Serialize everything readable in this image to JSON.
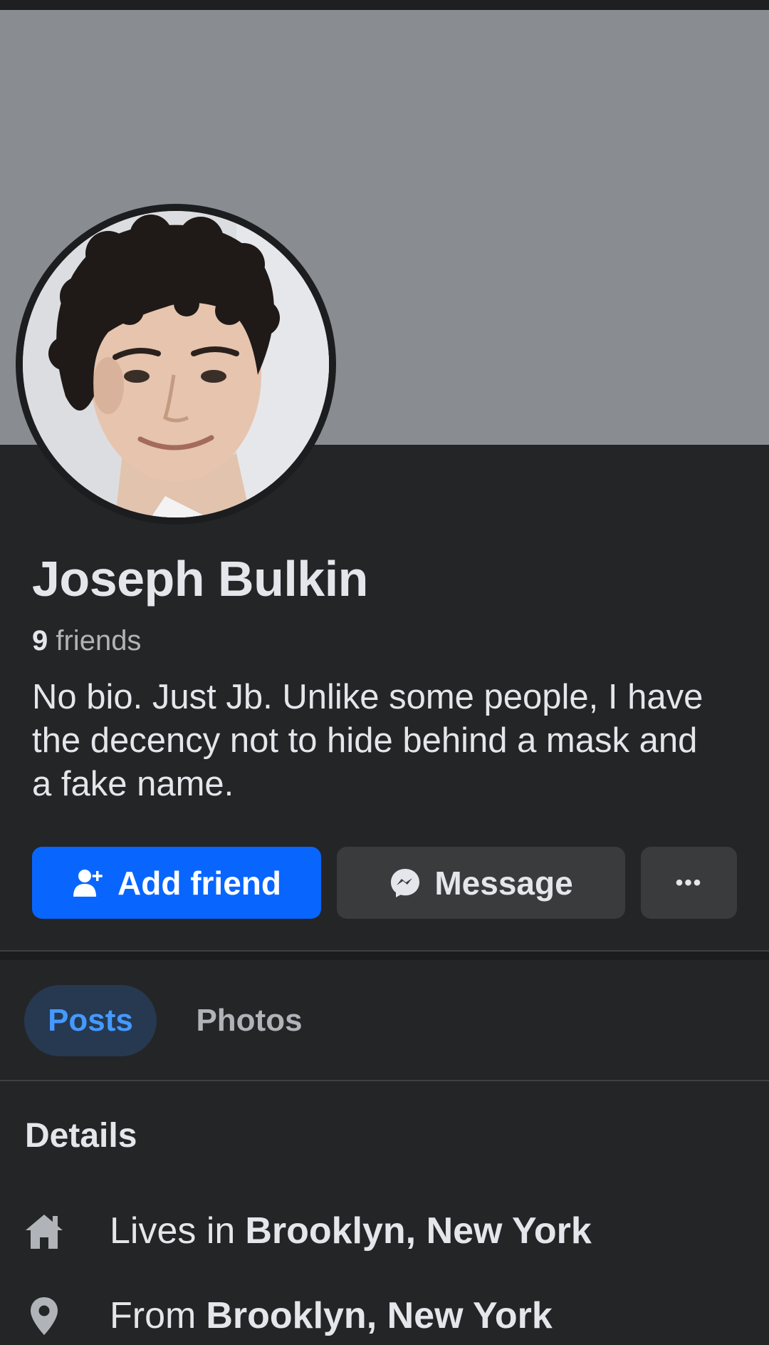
{
  "profile": {
    "name": "Joseph Bulkin",
    "friends_count": "9",
    "friends_label": "friends",
    "bio": "No bio. Just Jb. Unlike some people, I have the decency not to hide behind a mask and a fake name."
  },
  "actions": {
    "add_friend_label": "Add friend",
    "message_label": "Message",
    "more_label": "•••"
  },
  "tabs": [
    {
      "label": "Posts",
      "active": true
    },
    {
      "label": "Photos",
      "active": false
    }
  ],
  "details": {
    "title": "Details",
    "items": [
      {
        "icon": "home-icon",
        "prefix": "Lives in",
        "value": "Brooklyn, New York"
      },
      {
        "icon": "location-pin-icon",
        "prefix": "From",
        "value": "Brooklyn, New York"
      }
    ]
  },
  "colors": {
    "background": "#242526",
    "cover": "#898c91",
    "primary_button": "#0866ff",
    "secondary_button": "#3a3b3c",
    "active_tab_bg": "#263951",
    "active_tab_text": "#4599ff"
  }
}
